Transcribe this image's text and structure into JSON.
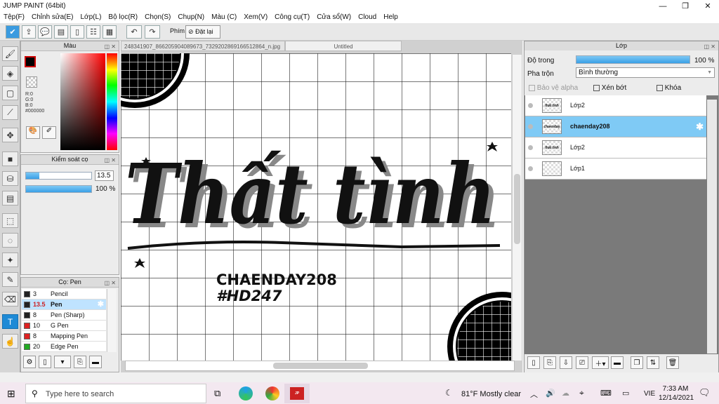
{
  "window": {
    "title": "JUMP PAINT (64bit)",
    "min": "—",
    "max": "❐",
    "close": "✕"
  },
  "menu": [
    "Tệp(F)",
    "Chỉnh sửa(E)",
    "Lớp(L)",
    "Bộ lọc(R)",
    "Chọn(S)",
    "Chụp(N)",
    "Màu (C)",
    "Xem(V)",
    "Công cụ(T)",
    "Cửa sổ(W)",
    "Cloud",
    "Help"
  ],
  "toolbar": {
    "keys_label": "Phím",
    "reset_label": "Đặt lại"
  },
  "color_panel": {
    "title": "Màu",
    "r": "R:0",
    "g": "G:0",
    "b": "B:0",
    "hex": "#000000",
    "primary": "#000000",
    "accent": "#cc0000"
  },
  "brush_control": {
    "title": "Kiểm soát cọ",
    "size": "13.5",
    "opacity": "100 %",
    "size_fraction": 0.2,
    "opacity_fraction": 1.0
  },
  "pen_panel": {
    "title": "Cọ: Pen",
    "brushes": [
      {
        "size": "3",
        "name": "Pencil",
        "color": "#222222"
      },
      {
        "size": "13.5",
        "name": "Pen",
        "color": "#222222"
      },
      {
        "size": "8",
        "name": "Pen (Sharp)",
        "color": "#222222"
      },
      {
        "size": "10",
        "name": "G Pen",
        "color": "#dd2222"
      },
      {
        "size": "8",
        "name": "Mapping Pen",
        "color": "#dd2222"
      },
      {
        "size": "20",
        "name": "Edge Pen",
        "color": "#22aa22"
      }
    ]
  },
  "canvas": {
    "tab1": "248341907_866205904089673_7329202869166512864_n.jpg",
    "tab2": "Untitled",
    "artwork_text": "Thất tình",
    "sub1": "CHAENDAY208",
    "sub2": "#HD247"
  },
  "layer_panel": {
    "title": "Lớp",
    "opacity_label": "Độ trong",
    "opacity_value": "100 %",
    "opacity_fraction": 1.0,
    "blend_label": "Pha trộn",
    "blend_value": "Bình thường",
    "protect_alpha": "Bảo vệ alpha",
    "clip": "Xén bớt",
    "lock": "Khóa",
    "layers": [
      {
        "name": "Lớp2",
        "thumb": "thất tình"
      },
      {
        "name": "chaenday208",
        "thumb": "chaenday"
      },
      {
        "name": "Lớp2",
        "thumb": "thất tình"
      },
      {
        "name": "Lớp1",
        "thumb": ""
      }
    ]
  },
  "taskbar": {
    "search_placeholder": "Type here to search",
    "weather": "81°F  Mostly clear",
    "lang": "VIE",
    "time": "7:33 AM",
    "date": "12/14/2021"
  }
}
